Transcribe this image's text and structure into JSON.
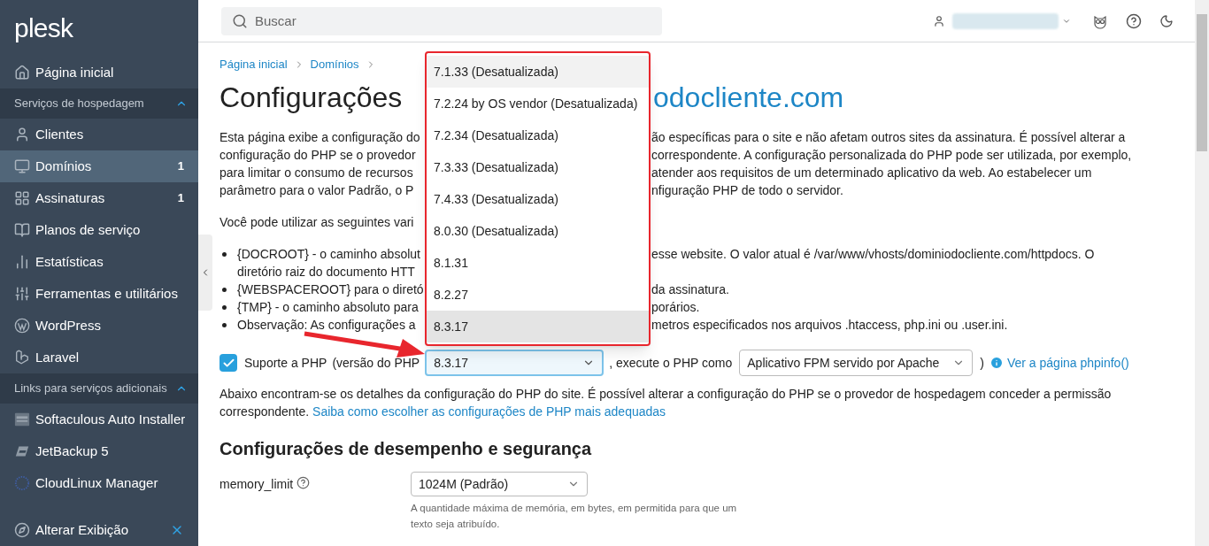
{
  "sidebar": {
    "logo": "plesk",
    "items": [
      {
        "kind": "item",
        "label": "Página inicial",
        "selected": false
      },
      {
        "kind": "section",
        "label": "Serviços de hospedagem",
        "expanded": true
      },
      {
        "kind": "item",
        "label": "Clientes",
        "selected": false
      },
      {
        "kind": "item",
        "label": "Domínios",
        "badge": "1",
        "selected": true
      },
      {
        "kind": "item",
        "label": "Assinaturas",
        "badge": "1",
        "selected": false
      },
      {
        "kind": "item",
        "label": "Planos de serviço",
        "selected": false
      },
      {
        "kind": "item",
        "label": "Estatísticas",
        "selected": false
      },
      {
        "kind": "item",
        "label": "Ferramentas e utilitários",
        "selected": false
      },
      {
        "kind": "item",
        "label": "WordPress",
        "selected": false
      },
      {
        "kind": "item",
        "label": "Laravel",
        "selected": false
      },
      {
        "kind": "section",
        "label": "Links para serviços adicionais",
        "expanded": true
      },
      {
        "kind": "item",
        "label": "Softaculous Auto Installer",
        "selected": false
      },
      {
        "kind": "item",
        "label": "JetBackup 5",
        "selected": false
      },
      {
        "kind": "item",
        "label": "CloudLinux Manager",
        "selected": false
      }
    ],
    "footer": {
      "label": "Alterar Exibição"
    }
  },
  "topbar": {
    "search": {
      "placeholder": "Buscar"
    }
  },
  "breadcrumbs": [
    "Página inicial",
    "Domínios"
  ],
  "title": {
    "left": "Configurações",
    "right": "odocliente.com"
  },
  "intro_lines": [
    {
      "left": "Esta página exibe a configuração do",
      "right": "ão específicas para o site e não afetam outros sites da assinatura. É possível alterar a"
    },
    {
      "left": "configuração do PHP se o provedor",
      "right": "correspondente. A configuração personalizada do PHP pode ser utilizada, por exemplo,"
    },
    {
      "left": "para limitar o consumo de recursos",
      "right": "atender aos requisitos de um determinado aplicativo da web. Ao estabelecer um"
    },
    {
      "left": "parâmetro para o valor Padrão, o P",
      "right": "nfiguração PHP de todo o servidor."
    }
  ],
  "variables_intro": "Você pode utilizar as seguintes vari",
  "bullets": [
    {
      "lines": [
        {
          "left": "{DOCROOT} - o caminho absolut",
          "right": "esse website. O valor atual é /var/www/vhosts/dominiodocliente.com/httpdocs. O"
        },
        {
          "left": "diretório raiz do documento HTT"
        }
      ]
    },
    {
      "lines": [
        {
          "left": "{WEBSPACEROOT} para o diretó",
          "right": "da assinatura."
        }
      ]
    },
    {
      "lines": [
        {
          "left": "{TMP} - o caminho absoluto para",
          "right": "porários."
        }
      ]
    },
    {
      "lines": [
        {
          "left": "Observação: As configurações a",
          "right": "metros especificados nos arquivos .htaccess, php.ini ou .user.ini."
        }
      ]
    }
  ],
  "php_row": {
    "checked": true,
    "label": "Suporte a PHP",
    "paren": "(versão do PHP",
    "version_value": "8.3.17",
    "run_as": ", execute o PHP como",
    "handler_value": "Aplicativo FPM servido por Apache",
    "close_paren": ")",
    "info_link": "Ver a página phpinfo()"
  },
  "details": {
    "text": "Abaixo encontram-se os detalhes da configuração do PHP do site. É possível alterar a configuração do PHP se o provedor de hospedagem conceder a permissão correspondente.",
    "link": "Saiba como escolher as configurações de PHP mais adequadas"
  },
  "section_title": "Configurações de desempenho e segurança",
  "settings": [
    {
      "name": "memory_limit",
      "value": "1024M (Padrão)",
      "hint": "A quantidade máxima de memória, em bytes, em permitida para que um texto seja atribuído."
    }
  ],
  "version_menu": {
    "options": [
      {
        "label": "7.1.33 (Desatualizada)",
        "selected": false,
        "hovered": true
      },
      {
        "label": "7.2.24 by OS vendor (Desatualizada)",
        "selected": false,
        "hovered": false
      },
      {
        "label": "7.2.34 (Desatualizada)",
        "selected": false,
        "hovered": false
      },
      {
        "label": "7.3.33 (Desatualizada)",
        "selected": false,
        "hovered": false
      },
      {
        "label": "7.4.33 (Desatualizada)",
        "selected": false,
        "hovered": false
      },
      {
        "label": "8.0.30 (Desatualizada)",
        "selected": false,
        "hovered": false
      },
      {
        "label": "8.1.31",
        "selected": false,
        "hovered": false
      },
      {
        "label": "8.2.27",
        "selected": false,
        "hovered": false
      },
      {
        "label": "8.3.17",
        "selected": true,
        "hovered": false
      }
    ]
  }
}
